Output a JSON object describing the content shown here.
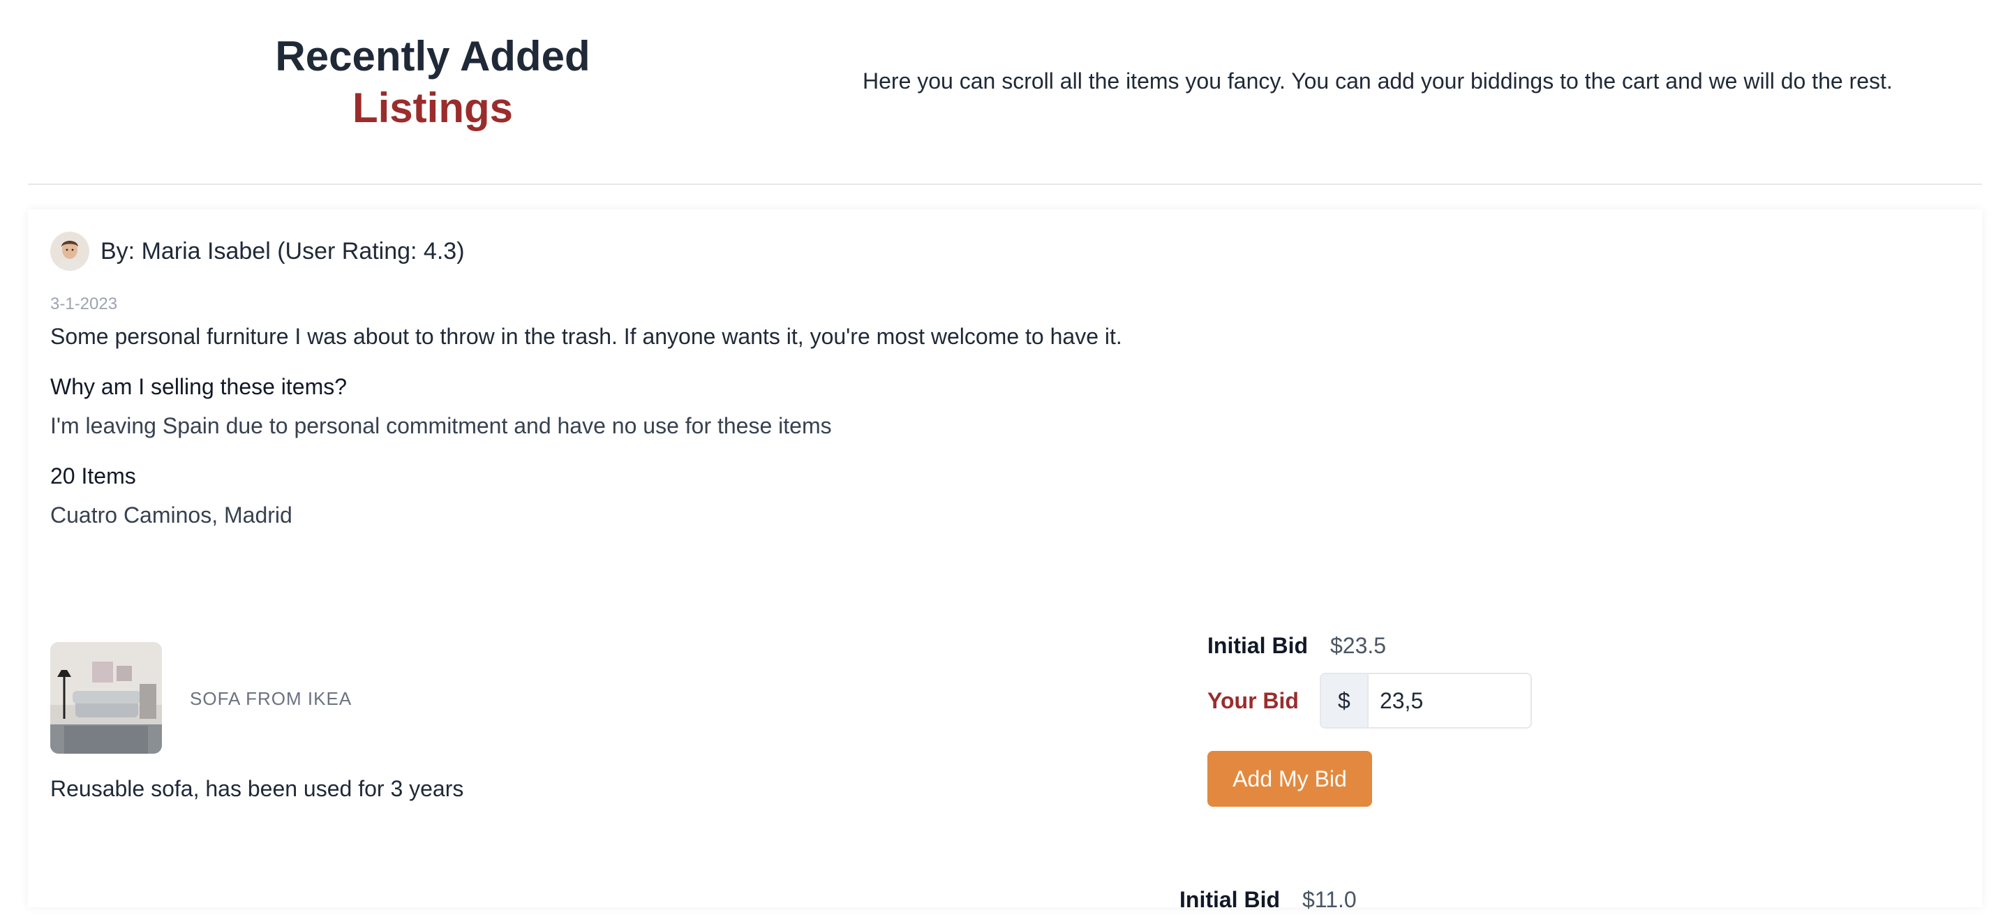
{
  "header": {
    "title_line1": "Recently Added",
    "title_line2": "Listings",
    "description": "Here you can scroll all the items you fancy. You can add your biddings to the cart and we will do the rest."
  },
  "listing": {
    "author": "By: Maria Isabel (User Rating: 4.3)",
    "date": "3-1-2023",
    "description": "Some personal furniture I was about to throw in the trash. If anyone wants it, you're most welcome to have it.",
    "why_heading": "Why am I selling these items?",
    "why_answer": "I'm leaving Spain due to personal commitment and have no use for these items",
    "items_count": "20 Items",
    "location": "Cuatro Caminos, Madrid"
  },
  "items": [
    {
      "name": "SOFA FROM IKEA",
      "description": "Reusable sofa, has been used for 3 years",
      "initial_bid_label": "Initial Bid",
      "initial_bid_value": "$23.5",
      "your_bid_label": "Your Bid",
      "currency": "$",
      "your_bid_value": "23,5",
      "button_label": "Add My Bid"
    },
    {
      "initial_bid_label": "Initial Bid",
      "initial_bid_value": "$11.0"
    }
  ],
  "colors": {
    "accent_red": "#9b2c2c",
    "button_orange": "#e3893f"
  }
}
